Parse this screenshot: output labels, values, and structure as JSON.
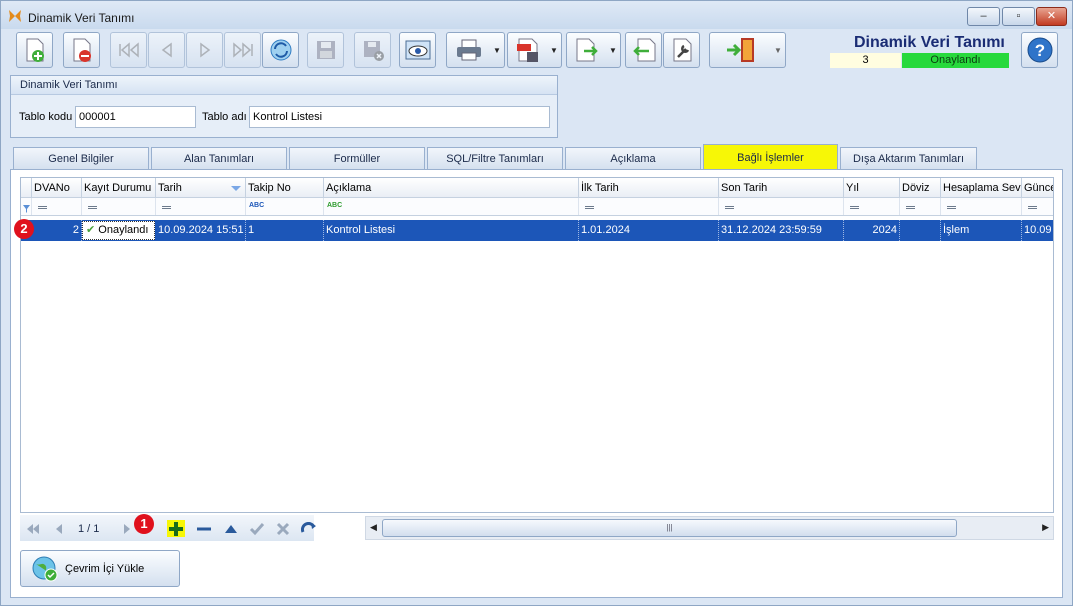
{
  "window": {
    "title": "Dinamik Veri Tanımı"
  },
  "header": {
    "title": "Dinamik Veri Tanımı",
    "record_no": "3",
    "status": "Onaylandı",
    "status_color": "#27d93c"
  },
  "toolbar": {
    "icons": [
      "new-doc-icon",
      "delete-doc-icon",
      "first-icon",
      "prev-icon",
      "next-icon",
      "last-icon",
      "refresh-icon",
      "save-icon",
      "save-close-icon",
      "preview-icon",
      "print-icon",
      "pdf-icon",
      "export-icon",
      "import-icon",
      "settings-icon",
      "exit-icon",
      "help-icon"
    ]
  },
  "group": {
    "title": "Dinamik Veri Tanımı",
    "code_label": "Tablo kodu",
    "code_value": "000001",
    "name_label": "Tablo adı",
    "name_value": "Kontrol Listesi"
  },
  "tabs": [
    "Genel Bilgiler",
    "Alan Tanımları",
    "Formüller",
    "SQL/Filtre Tanımları",
    "Açıklama",
    "Bağlı İşlemler",
    "Dışa Aktarım Tanımları"
  ],
  "active_tab": "Bağlı İşlemler",
  "active_tab_color": "#f7f706",
  "grid": {
    "columns": [
      "DVANo",
      "Kayıt Durumu",
      "Tarih",
      "Takip No",
      "Açıklama",
      "İlk Tarih",
      "Son Tarih",
      "Yıl",
      "Döviz",
      "Hesaplama Sevi",
      "Günce"
    ],
    "row": [
      "2",
      "Onaylandı",
      "10.09.2024 15:51",
      "1",
      "Kontrol Listesi",
      "1.01.2024",
      "31.12.2024 23:59:59",
      "2024",
      "",
      "İşlem",
      "10.09"
    ],
    "row_color": "#1c56b8"
  },
  "navigator": {
    "page": "1 / 1"
  },
  "badges": {
    "row": "2",
    "add": "1"
  },
  "buttons": {
    "load_online": "Çevrim İçi Yükle"
  }
}
